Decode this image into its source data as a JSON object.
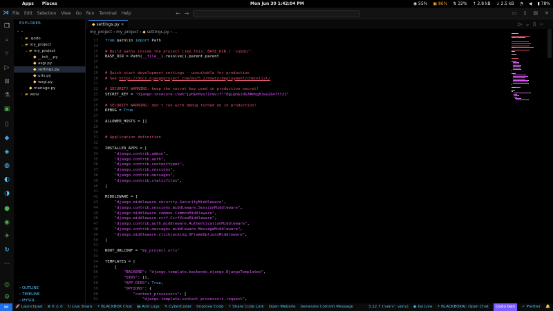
{
  "topbar": {
    "apps": "Apps",
    "places": "Places",
    "clock": "Mon Jun 30  1:42:04 PM",
    "indicators": [
      "55%",
      "86%",
      "32%",
      "2.8 kB",
      "2.5 kB",
      "78%"
    ]
  },
  "titlebar": {
    "menu": [
      "File",
      "Edit",
      "Selection",
      "View",
      "Go",
      "Run",
      "Terminal",
      "Help"
    ],
    "search_placeholder": ""
  },
  "sidebar": {
    "title": "EXPLORER",
    "root": "..",
    "tree": [
      {
        "label": ".qodo",
        "depth": 1,
        "type": "folder",
        "open": false
      },
      {
        "label": "my_project",
        "depth": 1,
        "type": "folder",
        "open": true
      },
      {
        "label": "my_project",
        "depth": 2,
        "type": "folder",
        "open": true
      },
      {
        "label": "__init__.py",
        "depth": 3,
        "type": "py"
      },
      {
        "label": "asgi.py",
        "depth": 3,
        "type": "py"
      },
      {
        "label": "settings.py",
        "depth": 3,
        "type": "py",
        "selected": true
      },
      {
        "label": "urls.py",
        "depth": 3,
        "type": "py"
      },
      {
        "label": "wsgi.py",
        "depth": 3,
        "type": "py"
      },
      {
        "label": "manage.py",
        "depth": 2,
        "type": "py"
      },
      {
        "label": "venv",
        "depth": 1,
        "type": "folder",
        "open": false
      }
    ],
    "bottom_sections": [
      "OUTLINE",
      "TIMELINE",
      "MYSQL"
    ]
  },
  "editor": {
    "tab_label": "settings.py",
    "breadcrumb": [
      "my_project",
      "my_project",
      "settings.py",
      "..."
    ],
    "lines": [
      {
        "n": 13,
        "t": [
          [
            "kw",
            "from "
          ],
          [
            "id",
            "pathlib "
          ],
          [
            "kw",
            "import "
          ],
          [
            "id",
            "Path"
          ]
        ]
      },
      {
        "n": 14,
        "t": []
      },
      {
        "n": 15,
        "t": [
          [
            "com",
            "# Build paths inside the project like this: BASE_DIR / 'subdir'."
          ]
        ]
      },
      {
        "n": 16,
        "t": [
          [
            "id",
            "BASE_DIR = Path("
          ],
          [
            "str",
            "__file__"
          ],
          [
            "id",
            ").resolve().parent.parent"
          ]
        ]
      },
      {
        "n": 17,
        "t": []
      },
      {
        "n": 18,
        "t": []
      },
      {
        "n": 19,
        "t": [
          [
            "com",
            "# Quick-start development settings - unsuitable for production"
          ]
        ]
      },
      {
        "n": 20,
        "t": [
          [
            "com",
            "# See "
          ],
          [
            "link",
            "https://docs.djangoproject.com/en/5.2/howto/deployment/checklist/"
          ]
        ]
      },
      {
        "n": 21,
        "t": []
      },
      {
        "n": 22,
        "t": [
          [
            "com",
            "# SECURITY WARNING: keep the secret key used in production secret!"
          ]
        ]
      },
      {
        "n": 23,
        "t": [
          [
            "id",
            "SECRET_KEY = "
          ],
          [
            "str",
            "\"django-insecure-i%w%^jyb$n0vs!1rwv(f!^0gj@n$id&7#m%g8)wu2&=ftt22\""
          ]
        ]
      },
      {
        "n": 24,
        "t": []
      },
      {
        "n": 25,
        "t": [
          [
            "com",
            "# SECURITY WARNING: don't run with debug turned on in production!"
          ]
        ]
      },
      {
        "n": 26,
        "t": [
          [
            "id",
            "DEBUG = "
          ],
          [
            "kw",
            "True"
          ]
        ]
      },
      {
        "n": 27,
        "t": []
      },
      {
        "n": 28,
        "t": [
          [
            "id",
            "ALLOWED_HOSTS = []"
          ]
        ]
      },
      {
        "n": 29,
        "t": []
      },
      {
        "n": 30,
        "t": []
      },
      {
        "n": 31,
        "t": [
          [
            "com",
            "# Application definition"
          ]
        ]
      },
      {
        "n": 32,
        "t": []
      },
      {
        "n": 33,
        "t": [
          [
            "id",
            "INSTALLED_APPS = ["
          ]
        ]
      },
      {
        "n": 34,
        "t": [
          [
            "id",
            "    "
          ],
          [
            "str",
            "\"django.contrib.admin\""
          ],
          [
            "id",
            ","
          ]
        ]
      },
      {
        "n": 35,
        "t": [
          [
            "id",
            "    "
          ],
          [
            "str",
            "\"django.contrib.auth\""
          ],
          [
            "id",
            ","
          ]
        ]
      },
      {
        "n": 36,
        "t": [
          [
            "id",
            "    "
          ],
          [
            "str",
            "\"django.contrib.contenttypes\""
          ],
          [
            "id",
            ","
          ]
        ]
      },
      {
        "n": 37,
        "t": [
          [
            "id",
            "    "
          ],
          [
            "str",
            "\"django.contrib.sessions\""
          ],
          [
            "id",
            ","
          ]
        ]
      },
      {
        "n": 38,
        "t": [
          [
            "id",
            "    "
          ],
          [
            "str",
            "\"django.contrib.messages\""
          ],
          [
            "id",
            ","
          ]
        ]
      },
      {
        "n": 39,
        "t": [
          [
            "id",
            "    "
          ],
          [
            "str",
            "\"django.contrib.staticfiles\""
          ],
          [
            "id",
            ","
          ]
        ]
      },
      {
        "n": 40,
        "t": [
          [
            "id",
            "]"
          ]
        ]
      },
      {
        "n": 41,
        "t": []
      },
      {
        "n": 42,
        "t": [
          [
            "id",
            "MIDDLEWARE = ["
          ]
        ]
      },
      {
        "n": 43,
        "t": [
          [
            "id",
            "    "
          ],
          [
            "str",
            "\"django.middleware.security.SecurityMiddleware\""
          ],
          [
            "id",
            ","
          ]
        ]
      },
      {
        "n": 44,
        "t": [
          [
            "id",
            "    "
          ],
          [
            "str",
            "\"django.contrib.sessions.middleware.SessionMiddleware\""
          ],
          [
            "id",
            ","
          ]
        ]
      },
      {
        "n": 45,
        "t": [
          [
            "id",
            "    "
          ],
          [
            "str",
            "\"django.middleware.common.CommonMiddleware\""
          ],
          [
            "id",
            ","
          ]
        ]
      },
      {
        "n": 46,
        "t": [
          [
            "id",
            "    "
          ],
          [
            "str",
            "\"django.middleware.csrf.CsrfViewMiddleware\""
          ],
          [
            "id",
            ","
          ]
        ]
      },
      {
        "n": 47,
        "t": [
          [
            "id",
            "    "
          ],
          [
            "str",
            "\"django.contrib.auth.middleware.AuthenticationMiddleware\""
          ],
          [
            "id",
            ","
          ]
        ]
      },
      {
        "n": 48,
        "t": [
          [
            "id",
            "    "
          ],
          [
            "str",
            "\"django.contrib.messages.middleware.MessageMiddleware\""
          ],
          [
            "id",
            ","
          ]
        ]
      },
      {
        "n": 49,
        "t": [
          [
            "id",
            "    "
          ],
          [
            "str",
            "\"django.middleware.clickjacking.XFrameOptionsMiddleware\""
          ],
          [
            "id",
            ","
          ]
        ]
      },
      {
        "n": 50,
        "t": [
          [
            "id",
            "]"
          ]
        ]
      },
      {
        "n": 51,
        "t": []
      },
      {
        "n": 52,
        "t": [
          [
            "id",
            "ROOT_URLCONF = "
          ],
          [
            "str",
            "\"my_project.urls\""
          ]
        ]
      },
      {
        "n": 53,
        "t": []
      },
      {
        "n": 54,
        "t": [
          [
            "id",
            "TEMPLATES = ["
          ]
        ]
      },
      {
        "n": 55,
        "t": [
          [
            "id",
            "    {"
          ]
        ]
      },
      {
        "n": 56,
        "t": [
          [
            "id",
            "        "
          ],
          [
            "str",
            "\"BACKEND\""
          ],
          [
            "id",
            ": "
          ],
          [
            "str",
            "\"django.template.backends.django.DjangoTemplates\""
          ],
          [
            "id",
            ","
          ]
        ]
      },
      {
        "n": 57,
        "t": [
          [
            "id",
            "        "
          ],
          [
            "str",
            "\"DIRS\""
          ],
          [
            "id",
            ": [],"
          ]
        ]
      },
      {
        "n": 58,
        "t": [
          [
            "id",
            "        "
          ],
          [
            "str",
            "\"APP_DIRS\""
          ],
          [
            "id",
            ": "
          ],
          [
            "kw",
            "True"
          ],
          [
            "id",
            ","
          ]
        ]
      },
      {
        "n": 59,
        "t": [
          [
            "id",
            "        "
          ],
          [
            "str",
            "\"OPTIONS\""
          ],
          [
            "id",
            ": {"
          ]
        ]
      },
      {
        "n": 60,
        "t": [
          [
            "id",
            "            "
          ],
          [
            "str",
            "\"context_processors\""
          ],
          [
            "id",
            ": ["
          ]
        ]
      },
      {
        "n": 61,
        "t": [
          [
            "id",
            "                "
          ],
          [
            "str",
            "\"django.template.context_processors.request\""
          ],
          [
            "id",
            ","
          ]
        ]
      }
    ]
  },
  "statusbar": {
    "left": [
      "Launchpad",
      "⊗ 0  ⚠ 0",
      "Live Share",
      "BLACKBOX Chat",
      "Add Logs",
      "CyberCoder",
      "Improve Code",
      "Share Code Link",
      "Open Website",
      "Generate Commit Message"
    ],
    "right": [
      "3.12.7 ('venv': venv)",
      "Go Live",
      "BLACKBOXAI: Open Chat",
      "Qodo Gen",
      "Prettier"
    ]
  },
  "colors": {
    "accent": "#4fc3f7",
    "string": "#e056fd",
    "comment": "#e0556a",
    "remote": "#1f6feb",
    "qodo": "#7b5cff"
  }
}
